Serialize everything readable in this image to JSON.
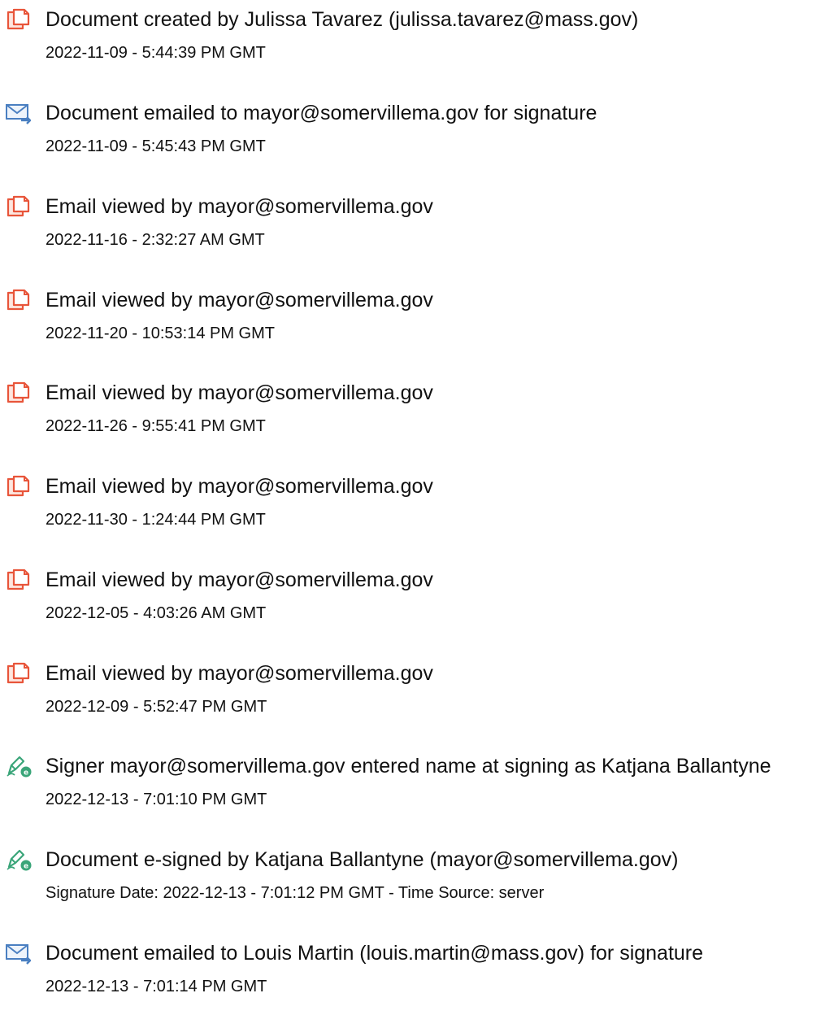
{
  "entries": [
    {
      "icon": "document-icon",
      "title": "Document created by Julissa Tavarez (julissa.tavarez@mass.gov)",
      "meta": "2022-11-09 - 5:44:39 PM GMT"
    },
    {
      "icon": "email-sent-icon",
      "title": "Document emailed to mayor@somervillema.gov for signature",
      "meta": "2022-11-09 - 5:45:43 PM GMT"
    },
    {
      "icon": "document-icon",
      "title": "Email viewed by mayor@somervillema.gov",
      "meta": "2022-11-16 - 2:32:27 AM GMT"
    },
    {
      "icon": "document-icon",
      "title": "Email viewed by mayor@somervillema.gov",
      "meta": "2022-11-20 - 10:53:14 PM GMT"
    },
    {
      "icon": "document-icon",
      "title": "Email viewed by mayor@somervillema.gov",
      "meta": "2022-11-26 - 9:55:41 PM GMT"
    },
    {
      "icon": "document-icon",
      "title": "Email viewed by mayor@somervillema.gov",
      "meta": "2022-11-30 - 1:24:44 PM GMT"
    },
    {
      "icon": "document-icon",
      "title": "Email viewed by mayor@somervillema.gov",
      "meta": "2022-12-05 - 4:03:26 AM GMT"
    },
    {
      "icon": "document-icon",
      "title": "Email viewed by mayor@somervillema.gov",
      "meta": "2022-12-09 - 5:52:47 PM GMT"
    },
    {
      "icon": "e-sign-icon",
      "title": "Signer mayor@somervillema.gov entered name at signing as Katjana Ballantyne",
      "meta": "2022-12-13 - 7:01:10 PM GMT"
    },
    {
      "icon": "e-sign-icon",
      "title": "Document e-signed by Katjana Ballantyne (mayor@somervillema.gov)",
      "meta": "Signature Date: 2022-12-13 - 7:01:12 PM GMT - Time Source: server"
    },
    {
      "icon": "email-sent-icon",
      "title": "Document emailed to Louis Martin (louis.martin@mass.gov) for signature",
      "meta": "2022-12-13 - 7:01:14 PM GMT"
    }
  ],
  "colors": {
    "document_icon": "#e8553a",
    "email_icon": "#4a7fc1",
    "sign_icon": "#3aa579"
  }
}
